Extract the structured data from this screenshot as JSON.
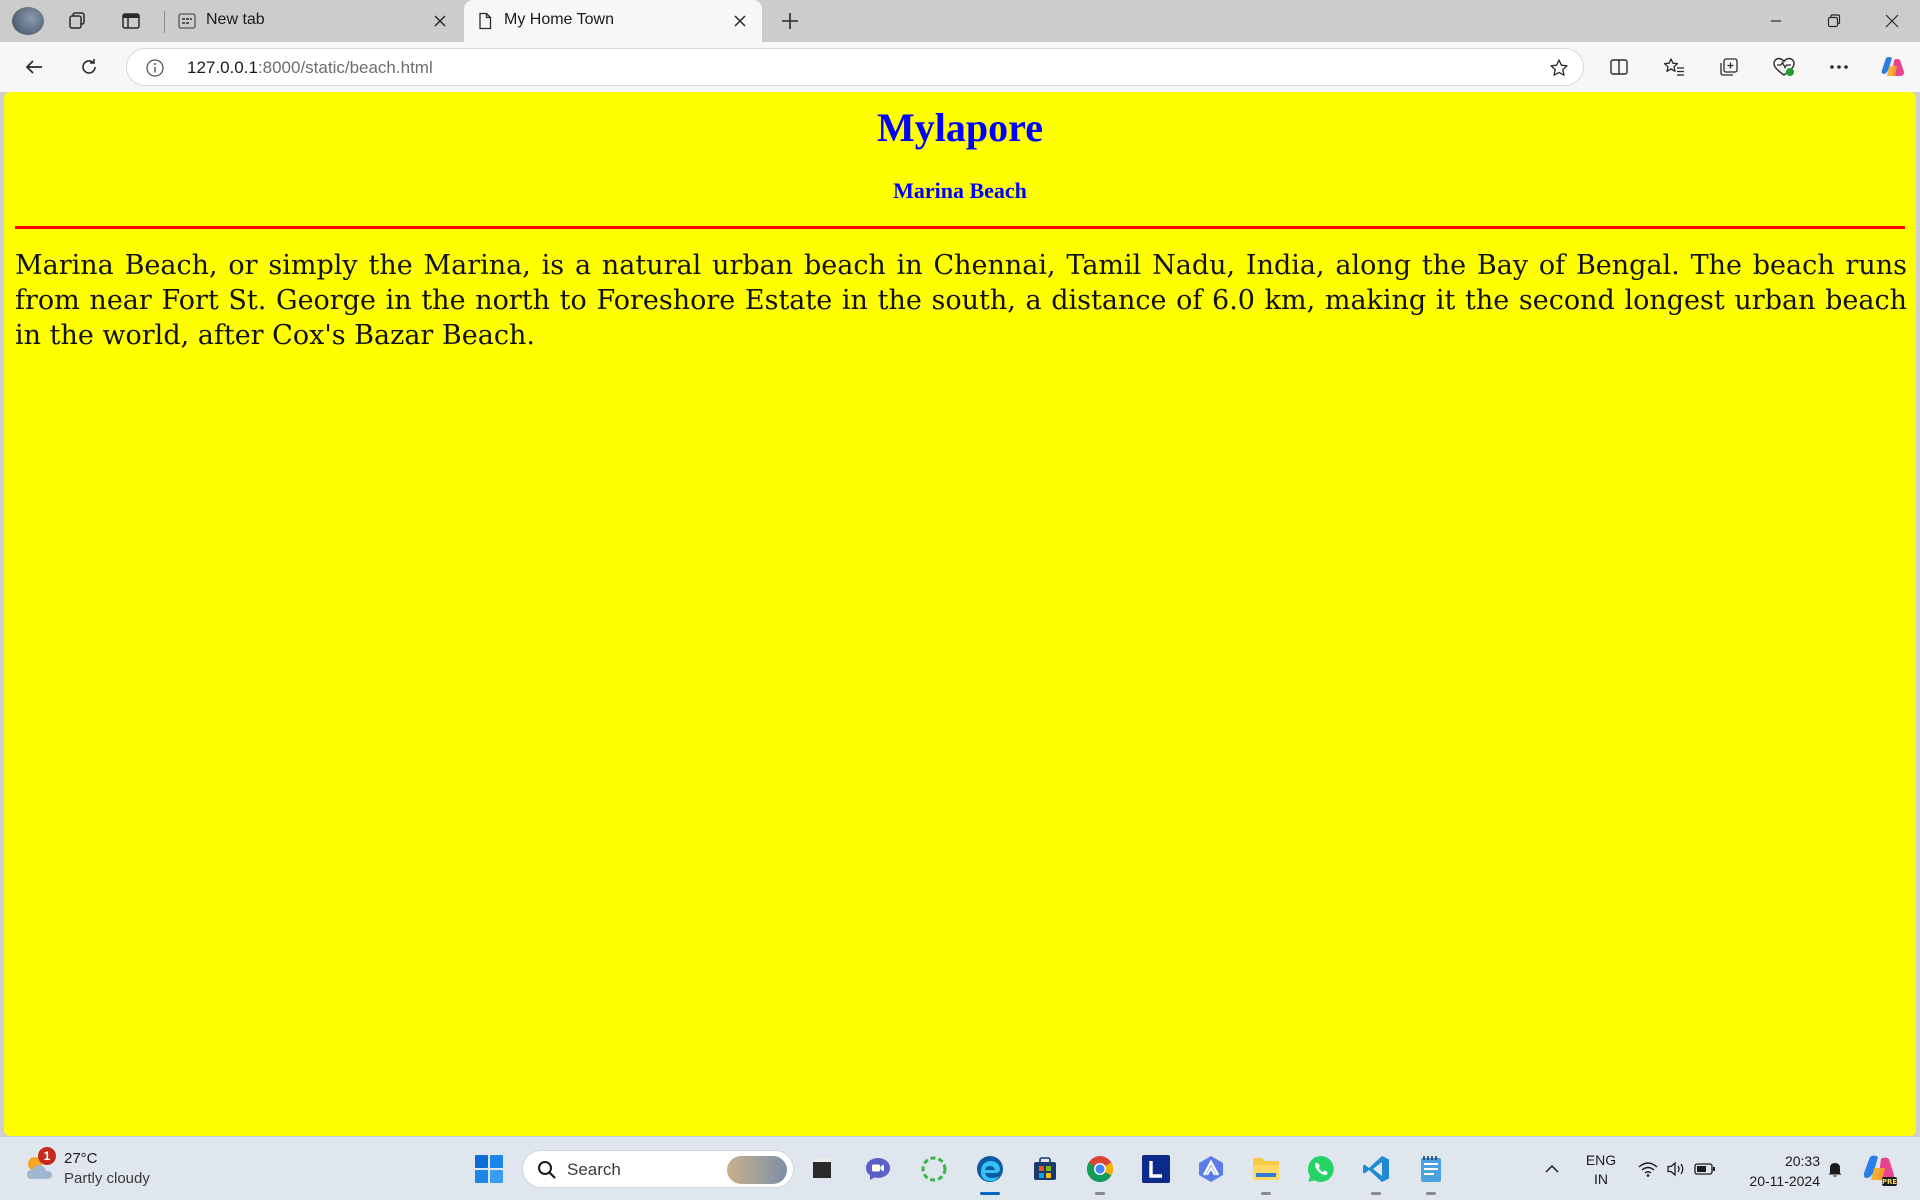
{
  "browser": {
    "tabs": [
      {
        "title": "New tab",
        "active": false,
        "icon": "new-tab-page-icon"
      },
      {
        "title": "My Home Town",
        "active": true,
        "icon": "document-icon"
      }
    ],
    "url_host": "127.0.0.1",
    "url_path": ":8000/static/beach.html"
  },
  "page": {
    "background_color": "#ffff00",
    "heading": "Mylapore",
    "subheading": "Marina Beach",
    "heading_color": "#0000ff",
    "rule_color": "#ff0000",
    "paragraph": "Marina Beach, or simply the Marina, is a natural urban beach in Chennai, Tamil Nadu, India, along the Bay of Bengal. The beach runs from near Fort St. George in the north to Foreshore Estate in the south, a distance of 6.0 km, making it the second longest urban beach in the world, after Cox's Bazar Beach."
  },
  "taskbar": {
    "weather": {
      "badge": "1",
      "temp": "27°C",
      "condition": "Partly cloudy"
    },
    "search_label": "Search",
    "pinned": [
      "start-icon",
      "file-icon",
      "meet-icon",
      "loading-app-icon",
      "edge-icon",
      "store-icon",
      "chrome-icon",
      "l-app-icon",
      "vpn-icon",
      "file-explorer-icon",
      "whatsapp-icon",
      "vscode-icon",
      "notepad-icon"
    ],
    "language": {
      "line1": "ENG",
      "line2": "IN"
    },
    "clock": {
      "time": "20:33",
      "date": "20-11-2024"
    }
  }
}
